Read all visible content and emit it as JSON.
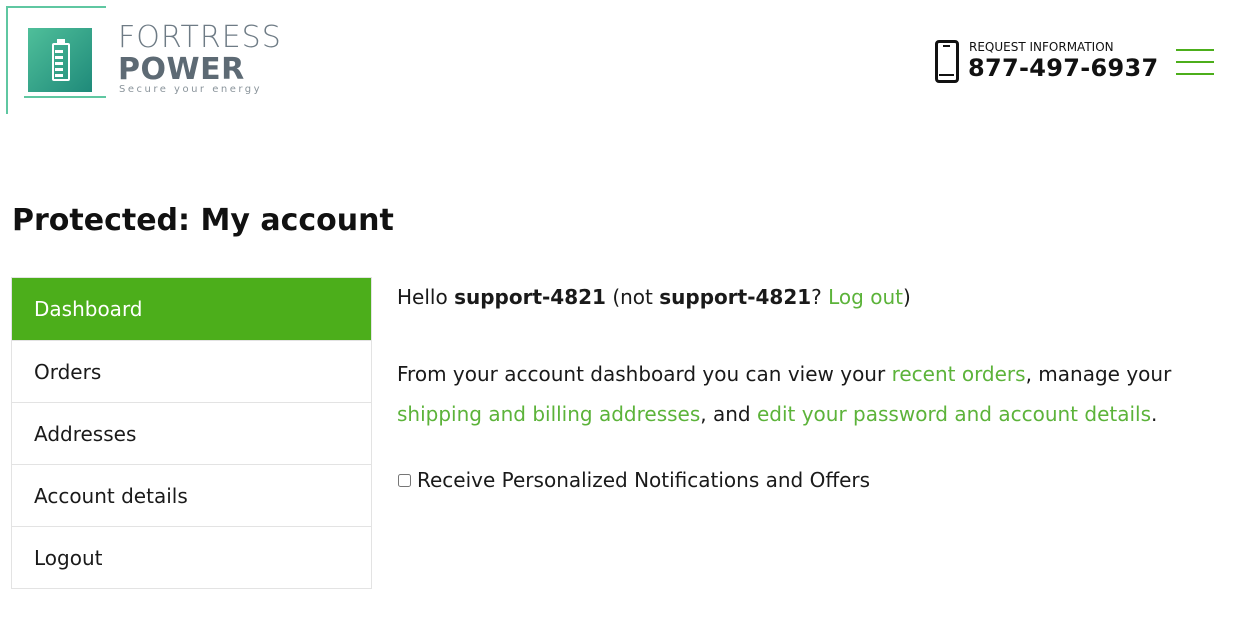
{
  "brand": {
    "name_line1": "FORTRESS",
    "name_line2": "POWER",
    "tagline": "Secure your energy",
    "accent_color": "#5fc7a1"
  },
  "header": {
    "contact_label": "REQUEST INFORMATION",
    "phone": "877-497-6937",
    "phone_icon": "mobile-phone-icon",
    "menu_icon": "hamburger-menu-icon"
  },
  "page": {
    "title": "Protected: My account"
  },
  "nav": {
    "active_color": "#4cae1b",
    "items": [
      {
        "label": "Dashboard",
        "active": true
      },
      {
        "label": "Orders",
        "active": false
      },
      {
        "label": "Addresses",
        "active": false
      },
      {
        "label": "Account details",
        "active": false
      },
      {
        "label": "Logout",
        "active": false
      }
    ]
  },
  "content": {
    "greeting_hello": "Hello ",
    "username": "support-4821",
    "greeting_not": " (not ",
    "greeting_q": "? ",
    "logout_link": "Log out",
    "greeting_close": ")",
    "intro_1": "From your account dashboard you can view your ",
    "recent_orders_link": "recent orders",
    "intro_2": ", manage your ",
    "addresses_link": "shipping and billing addresses",
    "intro_3": ", and ",
    "account_link": "edit your password and account details",
    "intro_4": ".",
    "optin_label": "Receive Personalized Notifications and Offers",
    "link_color": "#5cb33a"
  }
}
